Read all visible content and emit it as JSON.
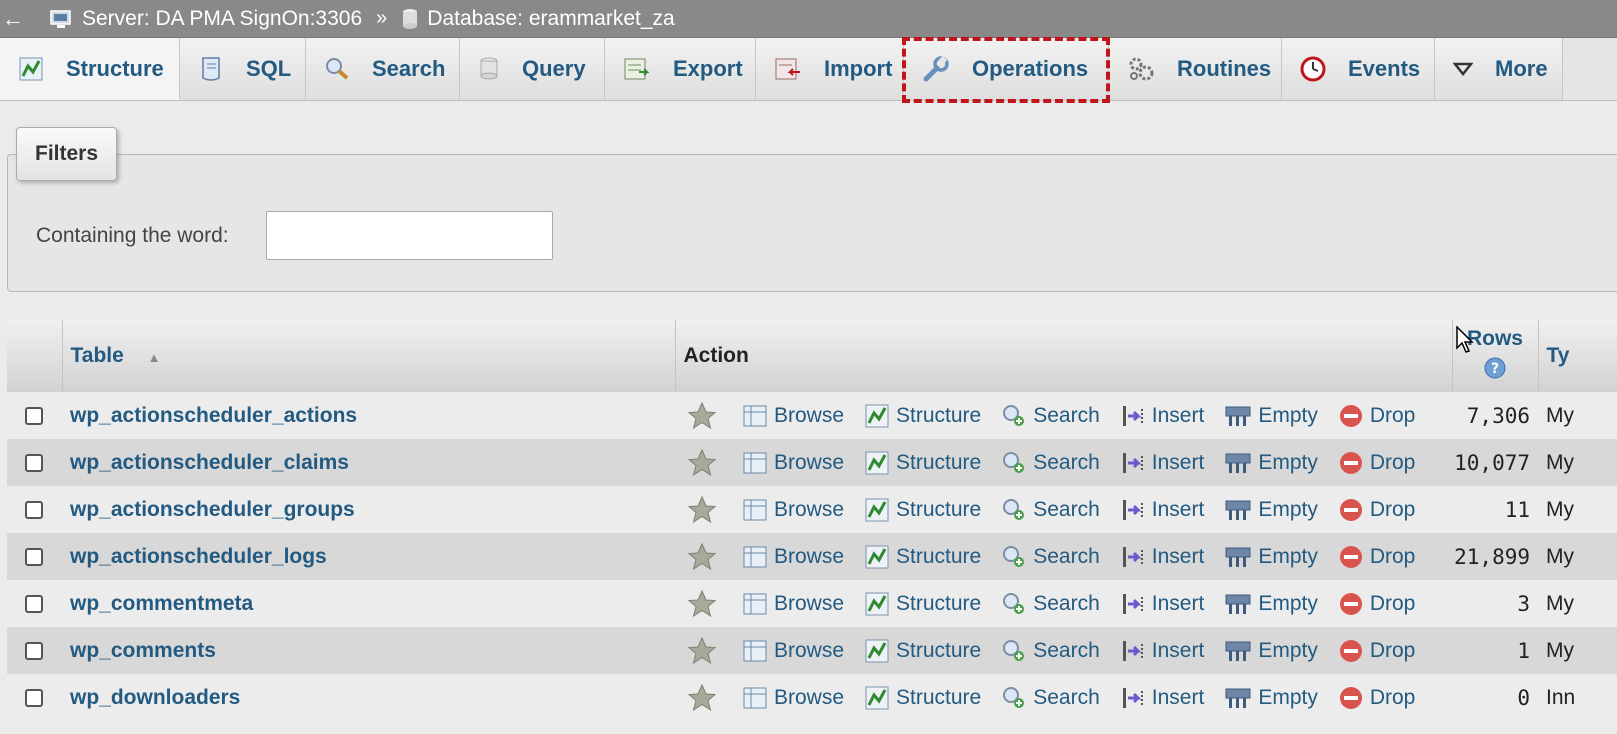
{
  "breadcrumb": {
    "back": "←",
    "server": "Server: DA PMA SignOn:3306",
    "separator": "»",
    "database": "Database: erammarket_za"
  },
  "tabs": [
    {
      "id": "structure",
      "label": "Structure",
      "icon": "structure-icon",
      "active": true
    },
    {
      "id": "sql",
      "label": "SQL",
      "icon": "sql-icon"
    },
    {
      "id": "search",
      "label": "Search",
      "icon": "search-icon"
    },
    {
      "id": "query",
      "label": "Query",
      "icon": "query-icon"
    },
    {
      "id": "export",
      "label": "Export",
      "icon": "export-icon"
    },
    {
      "id": "import",
      "label": "Import",
      "icon": "import-icon"
    },
    {
      "id": "operations",
      "label": "Operations",
      "icon": "wrench-icon",
      "highlighted": true
    },
    {
      "id": "routines",
      "label": "Routines",
      "icon": "routines-icon"
    },
    {
      "id": "events",
      "label": "Events",
      "icon": "clock-icon"
    },
    {
      "id": "more",
      "label": "More",
      "icon": "triangle-down-icon"
    }
  ],
  "filters": {
    "legend": "Filters",
    "label": "Containing the word:",
    "value": "",
    "placeholder": ""
  },
  "table": {
    "headers": {
      "table": "Table",
      "action": "Action",
      "rows": "Rows",
      "type": "Ty"
    },
    "actions": {
      "browse": "Browse",
      "structure": "Structure",
      "search": "Search",
      "insert": "Insert",
      "empty": "Empty",
      "drop": "Drop"
    },
    "rows": [
      {
        "name": "wp_actionscheduler_actions",
        "rows": "7,306",
        "type": "My"
      },
      {
        "name": "wp_actionscheduler_claims",
        "rows": "10,077",
        "type": "My"
      },
      {
        "name": "wp_actionscheduler_groups",
        "rows": "11",
        "type": "My"
      },
      {
        "name": "wp_actionscheduler_logs",
        "rows": "21,899",
        "type": "My"
      },
      {
        "name": "wp_commentmeta",
        "rows": "3",
        "type": "My"
      },
      {
        "name": "wp_comments",
        "rows": "1",
        "type": "My"
      },
      {
        "name": "wp_downloaders",
        "rows": "0",
        "type": "Inn"
      }
    ]
  },
  "colors": {
    "link": "#235a81",
    "highlight_border": "#c0161b",
    "drop_red": "#d9534f"
  }
}
